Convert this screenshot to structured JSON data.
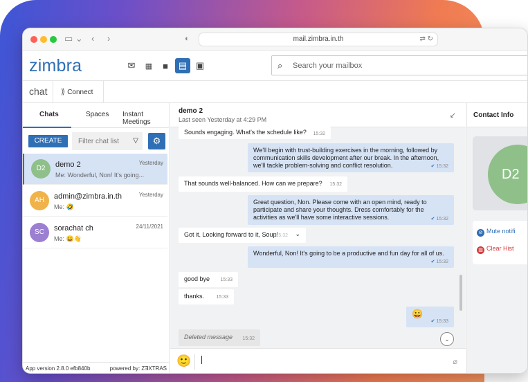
{
  "browser": {
    "url": "mail.zimbra.in.th"
  },
  "header": {
    "logo": "zimbra",
    "search_placeholder": "Search your mailbox",
    "app_icons": [
      "mail-icon",
      "calendar-icon",
      "briefcase-icon",
      "chat-icon",
      "contacts-icon"
    ],
    "accent": "#2f6fb5"
  },
  "modules": {
    "current": "chat",
    "connect_label": "Connect"
  },
  "sidebar": {
    "tabs": [
      "Chats",
      "Spaces",
      "Instant Meetings"
    ],
    "create_label": "CREATE",
    "filter_placeholder": "Filter chat list",
    "chats": [
      {
        "initials": "D2",
        "name": "demo 2",
        "preview": "Me: Wonderful, Non! It's going...",
        "time": "Yesterday",
        "color": "#8fc08a",
        "selected": true
      },
      {
        "initials": "AH",
        "name": "admin@zimbra.in.th",
        "preview": "Me: 🤣",
        "time": "Yesterday",
        "color": "#f0b24a",
        "selected": false
      },
      {
        "initials": "SC",
        "name": "sorachat ch",
        "preview": "Me: 😀👋",
        "time": "24/11/2021",
        "color": "#9b7fd1",
        "selected": false
      }
    ],
    "app_version": "App version 2.8.0 efb840b",
    "powered_by": "powered by: Z∃XTRAS"
  },
  "conversation": {
    "name": "demo 2",
    "last_seen": "Last seen Yesterday at 4:29 PM",
    "messages": [
      {
        "dir": "in",
        "text": "Sounds engaging. What's the schedule like?",
        "time": "15:32"
      },
      {
        "dir": "out",
        "text": "We'll begin with trust-building exercises in the morning, followed by communication skills development after our break. In the afternoon, we'll tackle problem-solving and conflict resolution.",
        "time": "15:32"
      },
      {
        "dir": "in",
        "text": "That sounds well-balanced. How can we prepare?",
        "time": "15:32"
      },
      {
        "dir": "out",
        "text": "Great question, Non. Please come with an open mind, ready to participate and share your thoughts. Dress comfortably for the activities as we'll have some interactive sessions.",
        "time": "15:32"
      },
      {
        "dir": "in",
        "text": "Got it. Looking forward to it, Soup!",
        "time": "15:32"
      },
      {
        "dir": "out",
        "text": "Wonderful, Non! It's going to be a productive and fun day for all of us.",
        "time": "15:32"
      },
      {
        "dir": "in",
        "text": "good bye",
        "time": "15:33"
      },
      {
        "dir": "in",
        "text": "thanks.",
        "time": "15:33"
      },
      {
        "dir": "out",
        "text": "😀",
        "time": "15:33"
      },
      {
        "dir": "deleted",
        "text": "Deleted message",
        "time": "15:32"
      }
    ]
  },
  "contact_info": {
    "title": "Contact Info",
    "initials": "D2",
    "mute_label": "Mute notifi",
    "clear_label": "Clear Hist"
  }
}
